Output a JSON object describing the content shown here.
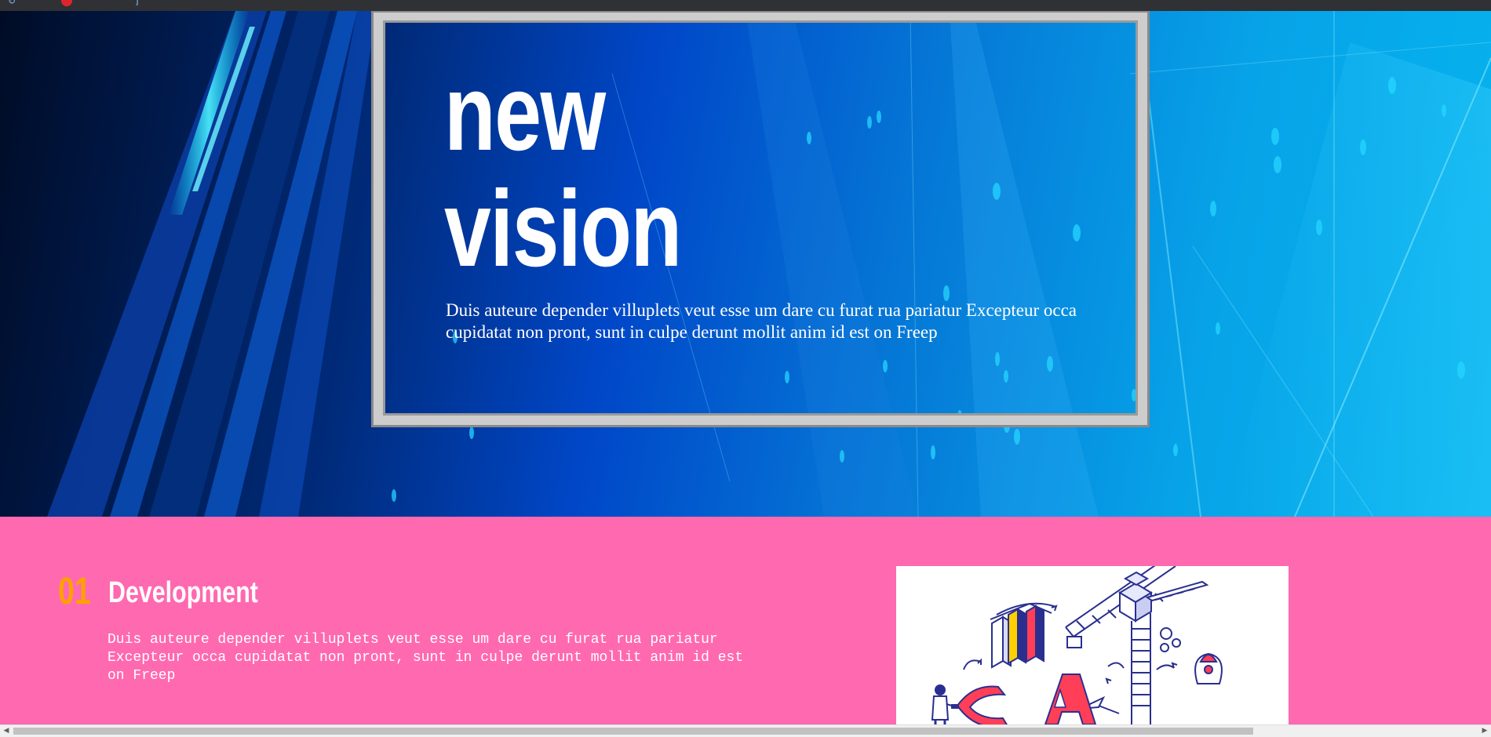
{
  "hero": {
    "title_line1": "new",
    "title_line2": "vision",
    "text": "Duis auteure depender villuplets veut esse um dare cu furat rua pariatur Excepteur occa cupidatat non pront, sunt in culpe derunt mollit anim id est on Freep"
  },
  "development": {
    "number": "01",
    "title": "Development",
    "text": "Duis auteure depender villuplets veut esse um dare cu furat rua pariatur Excepteur occa cupidatat non pront, sunt in culpe derunt mollit anim id est on Freep",
    "image_letters": "SEA"
  },
  "colors": {
    "pink_background": "#ff69b0",
    "number_orange": "#ffa200",
    "hero_frame": "#cdcdcd"
  },
  "icons": {
    "scroll_left": "chevron-left-icon",
    "scroll_right": "chevron-right-icon"
  }
}
